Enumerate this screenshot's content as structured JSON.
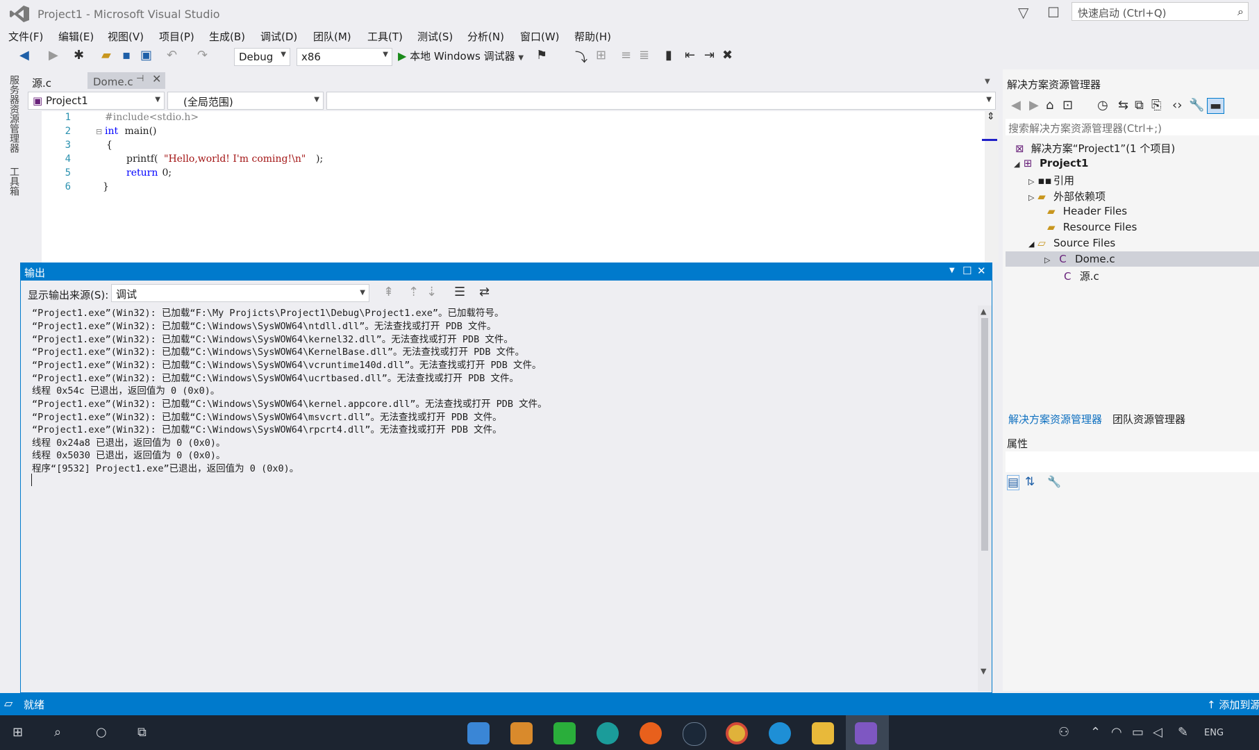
{
  "window": {
    "title": "Project1 - Microsoft Visual Studio",
    "quick_launch_placeholder": "快速启动 (Ctrl+Q)"
  },
  "menu": [
    "文件(F)",
    "编辑(E)",
    "视图(V)",
    "项目(P)",
    "生成(B)",
    "调试(D)",
    "团队(M)",
    "工具(T)",
    "测试(S)",
    "分析(N)",
    "窗口(W)",
    "帮助(H)"
  ],
  "toolbar": {
    "config": "Debug",
    "platform": "x86",
    "run_label": "本地 Windows 调试器"
  },
  "left_strip": [
    "服务器资源管理器",
    "工具箱"
  ],
  "editor": {
    "tabs": [
      {
        "label": "源.c",
        "active": true
      },
      {
        "label": "Dome.c",
        "active": false
      }
    ],
    "nav": {
      "project": "Project1",
      "scope": "(全局范围)",
      "member": ""
    },
    "line_numbers": [
      "1",
      "2",
      "3",
      "4",
      "5",
      "6"
    ],
    "code": {
      "l1": "#include<stdio.h>",
      "l2_kw": "int",
      "l2_rest": " main()",
      "l3": "{",
      "l4_fn": "printf(",
      "l4_str": "\"Hello,world! I'm coming!\\n\"",
      "l4_end": ");",
      "l5_kw": "return",
      "l5_rest": " 0;",
      "l6": "}"
    }
  },
  "output": {
    "title": "输出",
    "source_label": "显示输出来源(S):",
    "source_value": "调试",
    "lines": [
      "“Project1.exe”(Win32): 已加载“F:\\My Projicts\\Project1\\Debug\\Project1.exe”。已加载符号。",
      "“Project1.exe”(Win32): 已加载“C:\\Windows\\SysWOW64\\ntdll.dll”。无法查找或打开 PDB 文件。",
      "“Project1.exe”(Win32): 已加载“C:\\Windows\\SysWOW64\\kernel32.dll”。无法查找或打开 PDB 文件。",
      "“Project1.exe”(Win32): 已加载“C:\\Windows\\SysWOW64\\KernelBase.dll”。无法查找或打开 PDB 文件。",
      "“Project1.exe”(Win32): 已加载“C:\\Windows\\SysWOW64\\vcruntime140d.dll”。无法查找或打开 PDB 文件。",
      "“Project1.exe”(Win32): 已加载“C:\\Windows\\SysWOW64\\ucrtbased.dll”。无法查找或打开 PDB 文件。",
      "线程 0x54c 已退出，返回值为 0 (0x0)。",
      "“Project1.exe”(Win32): 已加载“C:\\Windows\\SysWOW64\\kernel.appcore.dll”。无法查找或打开 PDB 文件。",
      "“Project1.exe”(Win32): 已加载“C:\\Windows\\SysWOW64\\msvcrt.dll”。无法查找或打开 PDB 文件。",
      "“Project1.exe”(Win32): 已加载“C:\\Windows\\SysWOW64\\rpcrt4.dll”。无法查找或打开 PDB 文件。",
      "线程 0x24a8 已退出，返回值为 0 (0x0)。",
      "线程 0x5030 已退出，返回值为 0 (0x0)。",
      "程序“[9532] Project1.exe”已退出，返回值为 0 (0x0)。"
    ]
  },
  "solution_explorer": {
    "title": "解决方案资源管理器",
    "search_placeholder": "搜索解决方案资源管理器(Ctrl+;)",
    "tree": {
      "solution": "解决方案“Project1”(1 个项目)",
      "project": "Project1",
      "references": "引用",
      "external": "外部依赖项",
      "header": "Header Files",
      "resource": "Resource Files",
      "source": "Source Files",
      "dome": "Dome.c",
      "yuan": "源.c"
    },
    "tab_active": "解决方案资源管理器",
    "tab_other": "团队资源管理器"
  },
  "properties": {
    "title": "属性"
  },
  "status": {
    "text": "就绪",
    "right": "添加到源"
  },
  "colors": {
    "accent": "#007acc",
    "keyword": "#0000ff",
    "string": "#a31515",
    "line_number": "#2b91af"
  }
}
